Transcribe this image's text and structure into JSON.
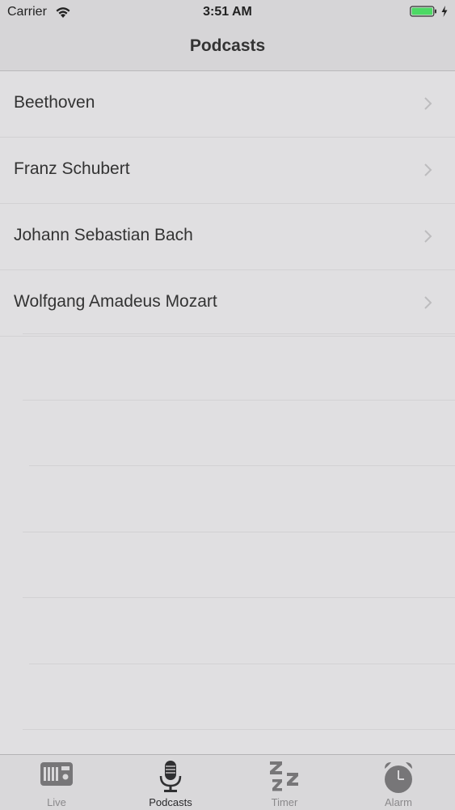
{
  "status_bar": {
    "carrier": "Carrier",
    "time": "3:51 AM",
    "battery_color": "#4cd964"
  },
  "nav": {
    "title": "Podcasts"
  },
  "podcasts": [
    {
      "label": "Beethoven"
    },
    {
      "label": "Franz Schubert"
    },
    {
      "label": "Johann Sebastian Bach"
    },
    {
      "label": "Wolfgang Amadeus Mozart"
    }
  ],
  "tabs": [
    {
      "label": "Live",
      "icon": "radio-icon"
    },
    {
      "label": "Podcasts",
      "icon": "microphone-icon",
      "active": true
    },
    {
      "label": "Timer",
      "icon": "sleep-zzz-icon"
    },
    {
      "label": "Alarm",
      "icon": "alarm-clock-icon"
    }
  ]
}
